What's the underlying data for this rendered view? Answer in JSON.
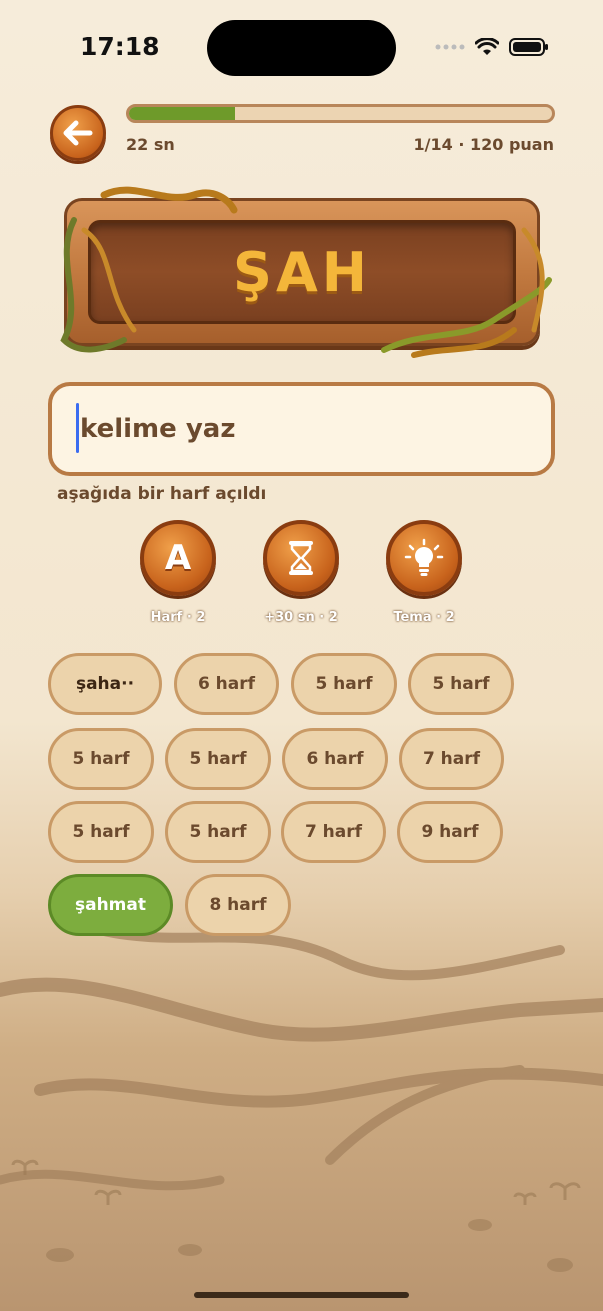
{
  "status_bar": {
    "time": "17:18"
  },
  "top_bar": {
    "back_icon": "arrow-left-icon",
    "progress": 0.25,
    "timer": "22 sn",
    "score": "1/14 · 120 puan"
  },
  "sign": {
    "word": "ŞAH"
  },
  "input": {
    "placeholder": "kelime yaz"
  },
  "hint": "aşağıda bir harf açıldı",
  "powerups": [
    {
      "icon": "letter-a-icon",
      "label": "Harf · 2"
    },
    {
      "icon": "hourglass-icon",
      "label": "+30 sn · 2"
    },
    {
      "icon": "lightbulb-icon",
      "label": "Tema · 2"
    }
  ],
  "chips": [
    {
      "label": "şaha··",
      "state": "partial"
    },
    {
      "label": "6 harf",
      "state": "hidden"
    },
    {
      "label": "5 harf",
      "state": "hidden"
    },
    {
      "label": "5 harf",
      "state": "hidden"
    },
    {
      "label": "5 harf",
      "state": "hidden"
    },
    {
      "label": "5 harf",
      "state": "hidden"
    },
    {
      "label": "6 harf",
      "state": "hidden"
    },
    {
      "label": "7 harf",
      "state": "hidden"
    },
    {
      "label": "5 harf",
      "state": "hidden"
    },
    {
      "label": "5 harf",
      "state": "hidden"
    },
    {
      "label": "7 harf",
      "state": "hidden"
    },
    {
      "label": "9 harf",
      "state": "hidden"
    },
    {
      "label": "şahmat",
      "state": "solved"
    },
    {
      "label": "8 harf",
      "state": "hidden"
    }
  ],
  "colors": {
    "accent": "#c8631c",
    "solved": "#7dad3e",
    "progress": "#6e9a2a",
    "sign_text": "#f4b63a"
  }
}
